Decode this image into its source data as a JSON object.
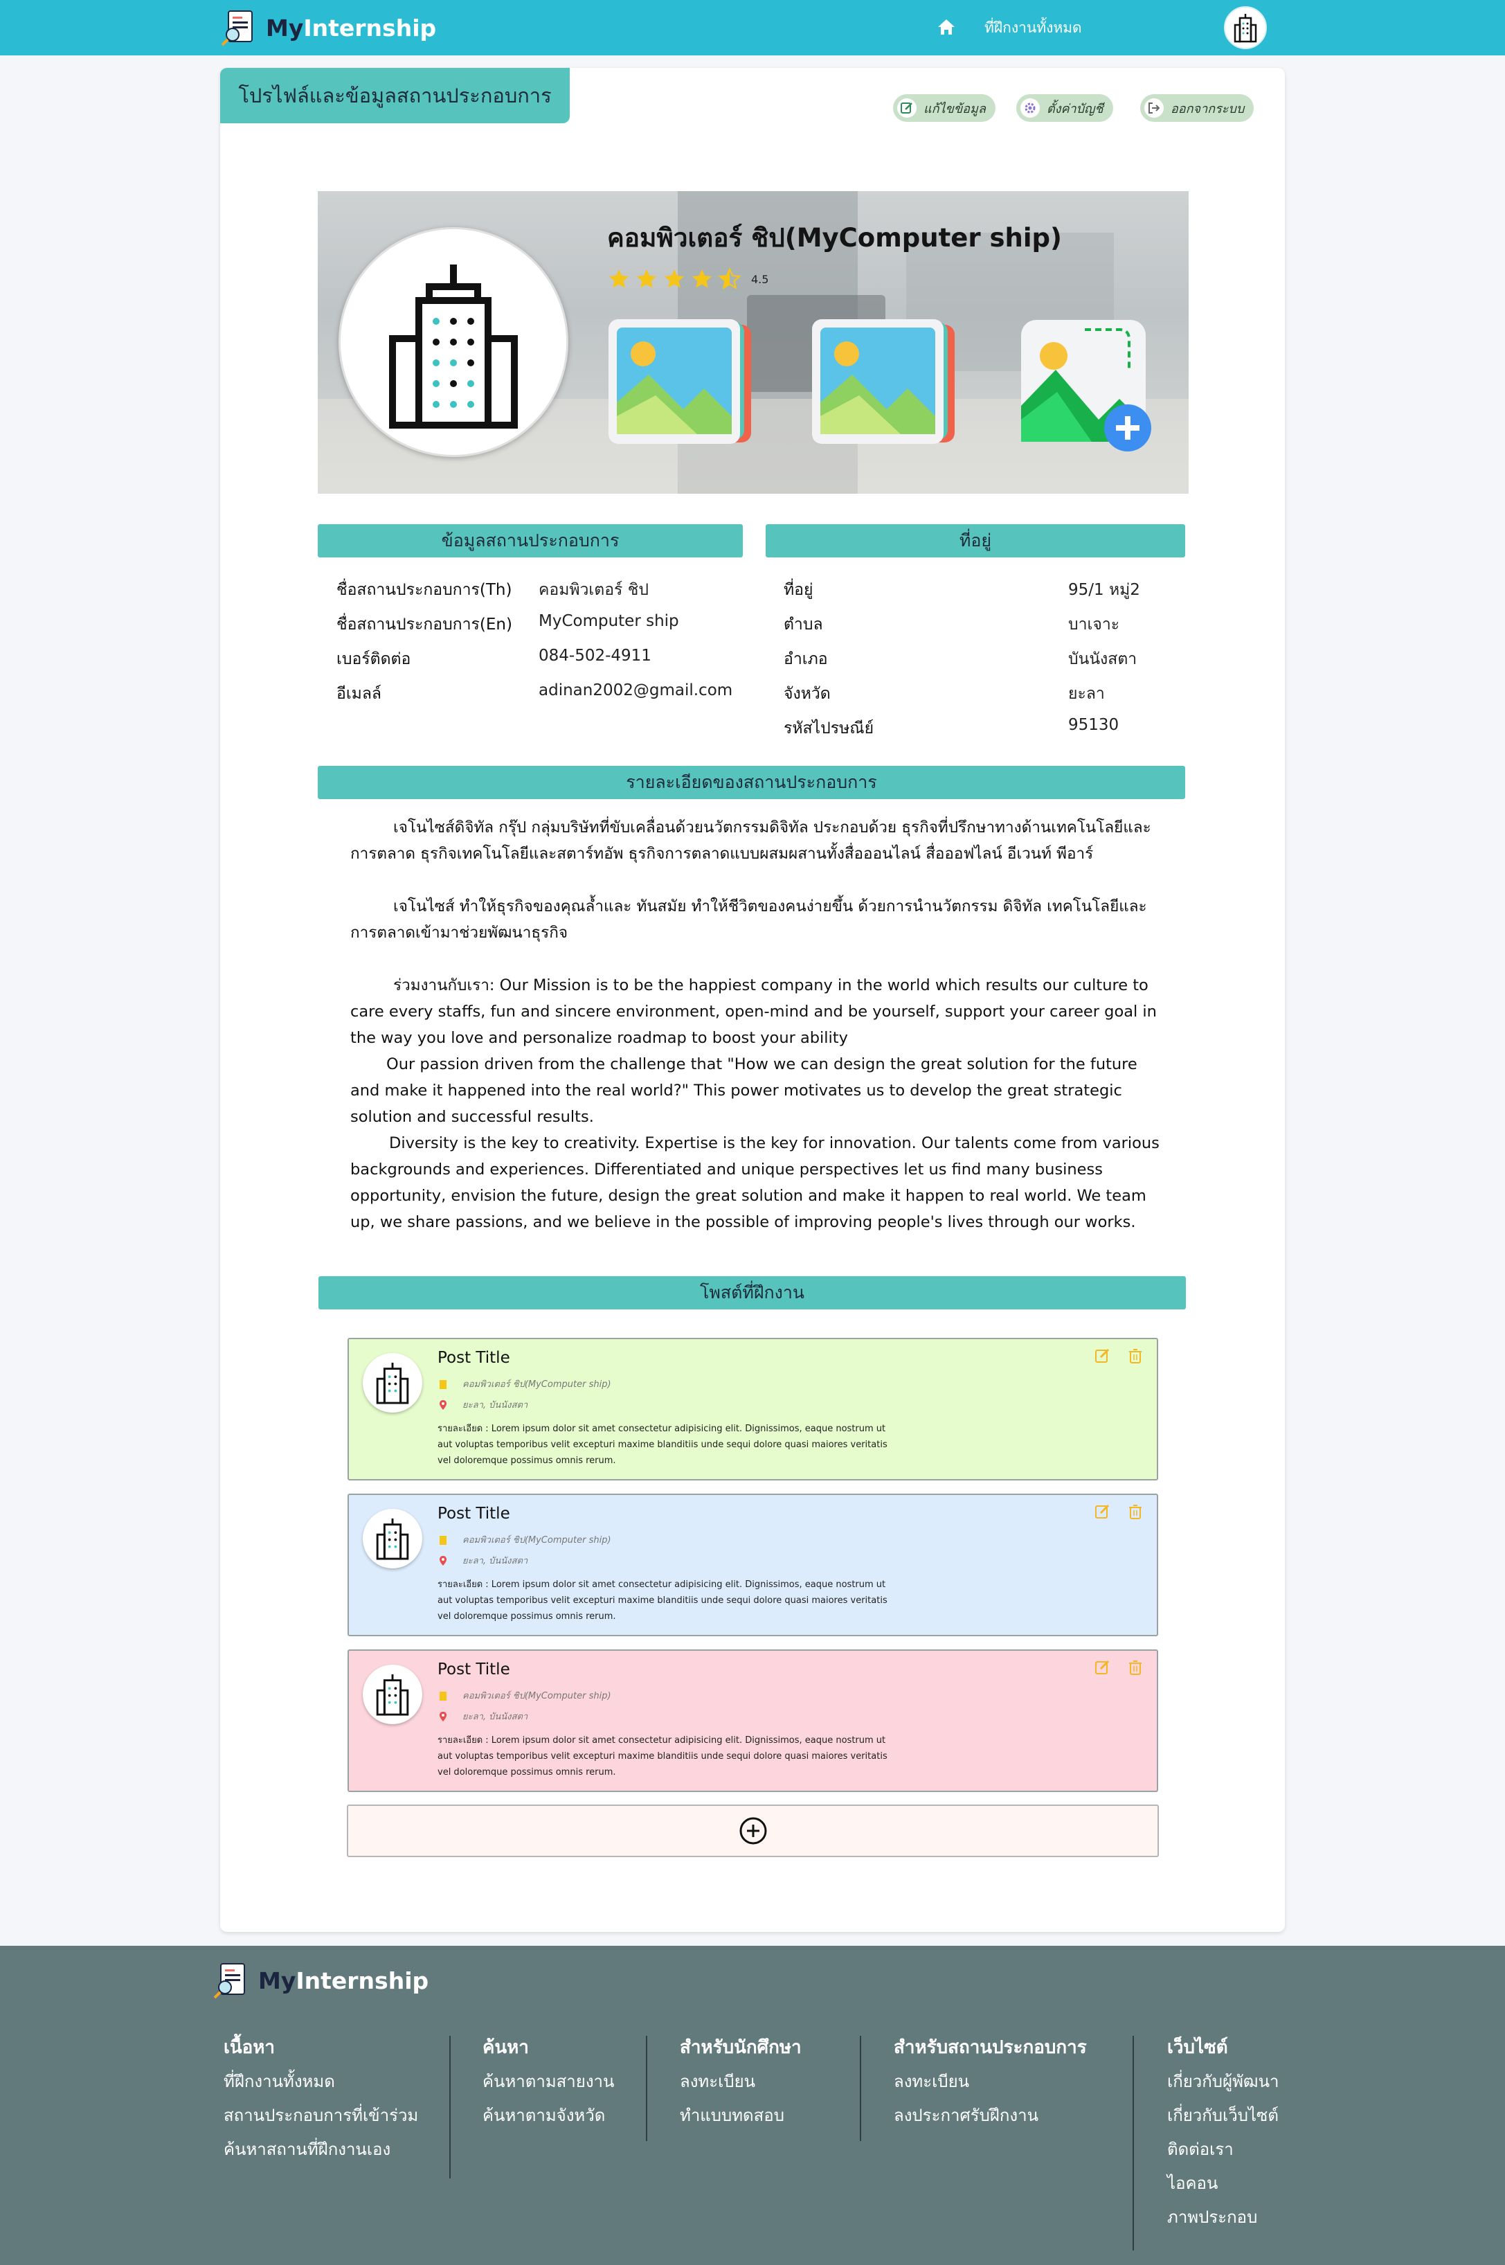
{
  "nav": {
    "brand_my": "My",
    "brand_internship": "Internship",
    "all_internships": "ที่ฝึกงานทั้งหมด"
  },
  "page": {
    "tab_title": "โปรไฟล์และข้อมูลสถานประกอบการ",
    "actions": {
      "edit": "แก้ไขข้อมูล",
      "settings": "ตั้งค่าบัญชี",
      "logout": "ออกจากระบบ"
    }
  },
  "company": {
    "title": "คอมพิวเตอร์ ชิป(MyComputer ship)",
    "rating": "4.5",
    "rating_value": 4.5,
    "rating_max": 5
  },
  "info_section": {
    "header": "ข้อมูลสถานประกอบการ",
    "rows": [
      {
        "label": "ชื่อสถานประกอบการ(Th)",
        "value": "คอมพิวเตอร์ ชิป"
      },
      {
        "label": "ชื่อสถานประกอบการ(En)",
        "value": "MyComputer ship"
      },
      {
        "label": "เบอร์ติดต่อ",
        "value": "084-502-4911"
      },
      {
        "label": "อีเมลล์",
        "value": "adinan2002@gmail.com"
      }
    ]
  },
  "address_section": {
    "header": "ที่อยู่",
    "rows": [
      {
        "label": "ที่อยู่",
        "value": "95/1 หมู่2"
      },
      {
        "label": "ตำบล",
        "value": "บาเจาะ"
      },
      {
        "label": "อำเภอ",
        "value": "บันนังสตา"
      },
      {
        "label": "จังหวัด",
        "value": "ยะลา"
      },
      {
        "label": "รหัสไปรษณีย์",
        "value": "95130"
      }
    ]
  },
  "detail_section": {
    "header": "รายละเอียดของสถานประกอบการ",
    "p1": "เจโนไซส์ดิจิทัล กรุ๊ป กลุ่มบริษัทที่ขับเคลื่อนด้วยนวัตกรรมดิจิทัล ประกอบด้วย ธุรกิจที่ปรึกษาทางด้านเทคโนโลยีและการตลาด  ธุรกิจเทคโนโลยีและสตาร์ทอัพ  ธุรกิจการตลาดแบบผสมผสานทั้งสื่อออนไลน์ สื่อออฟไลน์ อีเวนท์ พีอาร์",
    "p2": "เจโนไซส์ ทำให้ธุรกิจของคุณล้ำและ ทันสมัย ทำให้ชีวิตของคนง่ายขึ้น ด้วยการนำนวัตกรรม ดิจิทัล เทคโนโลยีและการตลาดเข้ามาช่วยพัฒนาธุรกิจ",
    "p3": "ร่วมงานกับเรา: Our Mission is to be the happiest company in the world which results our culture to care every staffs, fun and sincere environment, open-mind and be yourself, support your career goal in the way you love and personalize roadmap to boost your ability",
    "p4": "Our passion driven from the challenge that \"How we can design the great solution for the future and make it happened into the real world?\" This power motivates us to develop the great strategic solution and successful results.",
    "p5": "Diversity is the key to creativity. Expertise is the key for innovation. Our talents come from various backgrounds and experiences. Differentiated and unique perspectives let us find many business opportunity, envision the future, design the great solution and make it happen to real world. We team up, we share passions, and we believe in the possible of improving people's lives through our works."
  },
  "posts_section": {
    "header": "โพสต์ที่ฝึกงาน",
    "posts": [
      {
        "title": "Post Title",
        "company": "คอมพิวเตอร์ ชิป(MyComputer ship)",
        "location": "ยะลา, บันนังสตา",
        "detail": "รายละเอียด : Lorem ipsum dolor sit amet consectetur adipisicing elit. Dignissimos, eaque nostrum ut aut voluptas temporibus velit excepturi maxime blanditiis unde sequi dolore quasi maiores veritatis vel doloremque possimus omnis rerum.",
        "color": "#e6fccc"
      },
      {
        "title": "Post Title",
        "company": "คอมพิวเตอร์ ชิป(MyComputer ship)",
        "location": "ยะลา, บันนังสตา",
        "detail": "รายละเอียด : Lorem ipsum dolor sit amet consectetur adipisicing elit. Dignissimos, eaque nostrum ut aut voluptas temporibus velit excepturi maxime blanditiis unde sequi dolore quasi maiores veritatis vel doloremque possimus omnis rerum.",
        "color": "#dcecfc"
      },
      {
        "title": "Post Title",
        "company": "คอมพิวเตอร์ ชิป(MyComputer ship)",
        "location": "ยะลา, บันนังสตา",
        "detail": "รายละเอียด : Lorem ipsum dolor sit amet consectetur adipisicing elit. Dignissimos, eaque nostrum ut aut voluptas temporibus velit excepturi maxime blanditiis unde sequi dolore quasi maiores veritatis vel doloremque possimus omnis rerum.",
        "color": "#fcd6dc"
      }
    ]
  },
  "footer": {
    "brand_my": "My",
    "brand_internship": "Internship",
    "columns": [
      {
        "title": "เนื้อหา",
        "links": [
          "ที่ฝึกงานทั้งหมด",
          "สถานประกอบการที่เข้าร่วม",
          "ค้นหาสถานที่ฝึกงานเอง"
        ]
      },
      {
        "title": "ค้นหา",
        "links": [
          "ค้นหาตามสายงาน",
          "ค้นหาตามจังหวัด"
        ]
      },
      {
        "title": "สำหรับนักศึกษา",
        "links": [
          "ลงทะเบียน",
          "ทำแบบทดสอบ"
        ]
      },
      {
        "title": "สำหรับสถานประกอบการ",
        "links": [
          "ลงทะเบียน",
          "ลงประกาศรับฝึกงาน"
        ]
      },
      {
        "title": "เว็บไซต์",
        "links": [
          "เกี่ยวกับผู้พัฒนา",
          "เกี่ยวกับเว็บไซต์",
          "ติดต่อเรา",
          "ไอคอน",
          "ภาพประกอบ"
        ]
      }
    ]
  },
  "colors": {
    "topbar": "#2bbcd3",
    "accent": "#56c4bc",
    "footer": "#627a7c",
    "star": "#f5c518"
  },
  "icons": [
    "brand-logo-icon",
    "home-icon",
    "building-icon",
    "edit-icon",
    "gear-icon",
    "logout-icon",
    "star-icon",
    "image-icon",
    "add-image-icon",
    "pin-icon",
    "trash-icon",
    "plus-circle-icon"
  ]
}
